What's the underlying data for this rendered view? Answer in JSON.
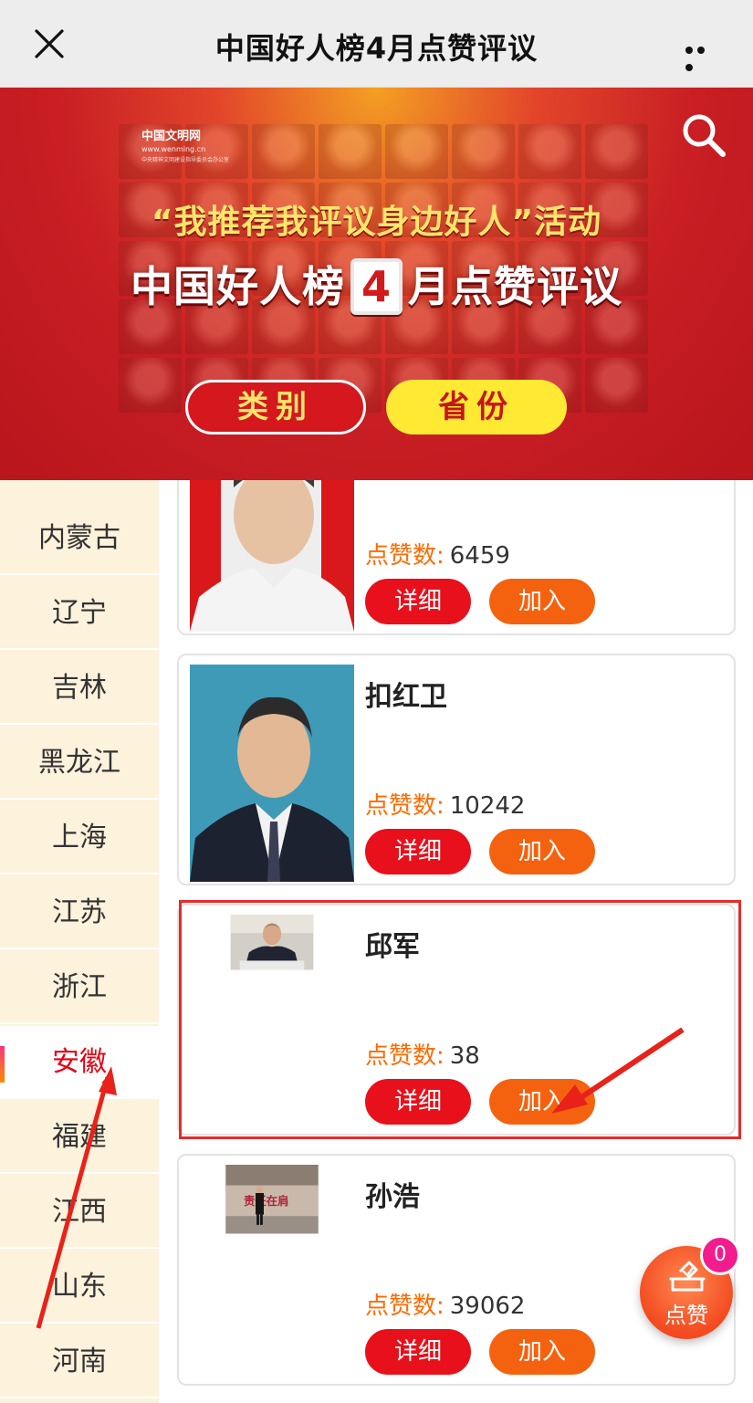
{
  "topbar": {
    "title": "中国好人榜4月点赞评议"
  },
  "banner": {
    "logo_name": "中国文明网",
    "logo_url": "www.wenming.cn",
    "logo_sub": "中央精神文明建设指导委员会办公室",
    "slogan": "“我推荐我评议身边好人”活动",
    "headline_prefix": "中国好人榜",
    "headline_num": "4",
    "headline_suffix": "月点赞评议",
    "btn_category": "类别",
    "btn_province": "省份"
  },
  "sidebar": {
    "items": [
      "内蒙古",
      "辽宁",
      "吉林",
      "黑龙江",
      "上海",
      "江苏",
      "浙江",
      "安徽",
      "福建",
      "江西",
      "山东",
      "河南"
    ],
    "active": "安徽"
  },
  "cards": [
    {
      "name": "",
      "likes_label": "点赞数:",
      "likes": "6459",
      "detail": "详细",
      "join": "加入"
    },
    {
      "name": "扣红卫",
      "likes_label": "点赞数:",
      "likes": "10242",
      "detail": "详细",
      "join": "加入"
    },
    {
      "name": "邱军",
      "likes_label": "点赞数:",
      "likes": "38",
      "detail": "详细",
      "join": "加入"
    },
    {
      "name": "孙浩",
      "likes_label": "点赞数:",
      "likes": "39062",
      "detail": "详细",
      "join": "加入"
    }
  ],
  "float": {
    "label": "点赞",
    "badge": "0"
  },
  "colors": {
    "accent_red": "#e8101b",
    "orange": "#f5620f",
    "sidebar_bg": "#fdf2dc",
    "banner_red": "#c81e24"
  }
}
